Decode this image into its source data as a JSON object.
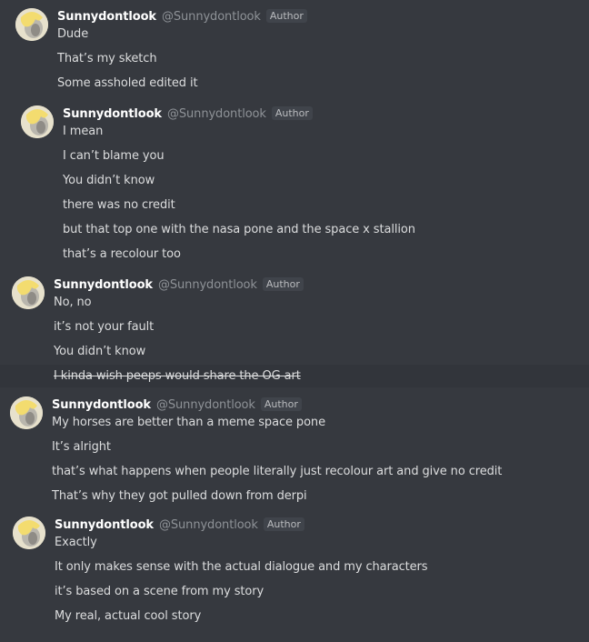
{
  "author_badge": "Author",
  "messages": [
    {
      "name": "Sunnydontlook",
      "handle": "@Sunnydontlook",
      "lines": [
        "Dude",
        "That’s my sketch",
        "Some assholed edited it"
      ]
    },
    {
      "name": "Sunnydontlook",
      "handle": "@Sunnydontlook",
      "lines": [
        "I mean",
        "I can’t blame you",
        "You didn’t know",
        "there was no credit",
        "but that top one with the nasa pone and the space x stallion",
        "that’s a recolour too"
      ]
    },
    {
      "name": "Sunnydontlook",
      "handle": "@Sunnydontlook",
      "lines": [
        "No, no",
        "it’s not your fault",
        "You didn’t know",
        "I kinda wish peeps would share the OG art"
      ]
    },
    {
      "name": "Sunnydontlook",
      "handle": "@Sunnydontlook",
      "lines": [
        "My horses are better than a meme space pone",
        "It’s alright",
        "that’s what happens when people literally just recolour art and give no credit",
        "That’s why they got pulled down from derpi"
      ]
    },
    {
      "name": "Sunnydontlook",
      "handle": "@Sunnydontlook",
      "lines": [
        "Exactly",
        "It only makes sense with the actual dialogue and my characters",
        "it’s based on a scene from my story",
        "My real, actual cool story"
      ]
    }
  ]
}
